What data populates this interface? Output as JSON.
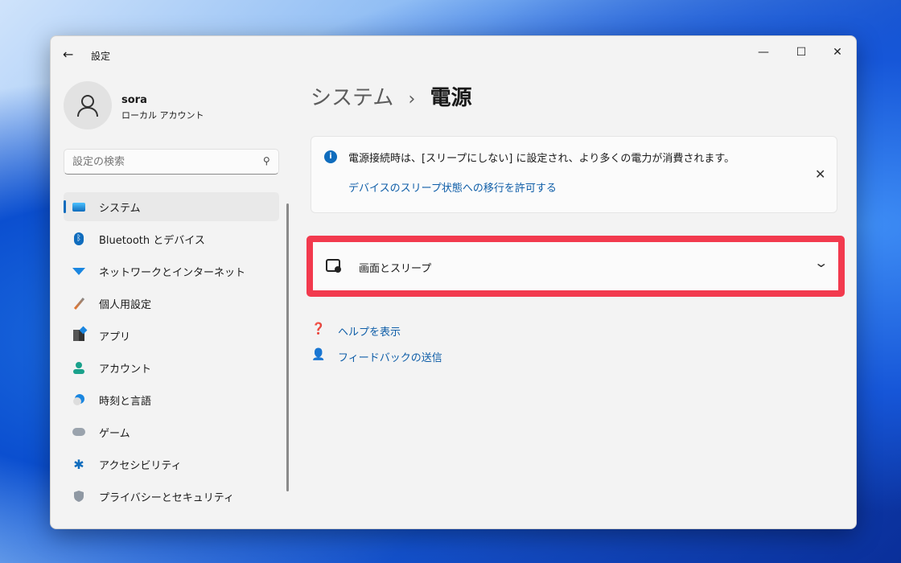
{
  "window": {
    "title": "設定",
    "back": "←",
    "minimize": "—",
    "maximize": "☐",
    "close": "✕"
  },
  "user": {
    "name": "sora",
    "type": "ローカル アカウント"
  },
  "search": {
    "placeholder": "設定の検索"
  },
  "sidebar": {
    "items": [
      {
        "label": "システム",
        "icon": "system-icon",
        "selected": true
      },
      {
        "label": "Bluetooth とデバイス",
        "icon": "bluetooth-icon"
      },
      {
        "label": "ネットワークとインターネット",
        "icon": "wifi-icon"
      },
      {
        "label": "個人用設定",
        "icon": "brush-icon"
      },
      {
        "label": "アプリ",
        "icon": "apps-icon"
      },
      {
        "label": "アカウント",
        "icon": "account-icon"
      },
      {
        "label": "時刻と言語",
        "icon": "clock-globe-icon"
      },
      {
        "label": "ゲーム",
        "icon": "gamepad-icon"
      },
      {
        "label": "アクセシビリティ",
        "icon": "accessibility-icon"
      },
      {
        "label": "プライバシーとセキュリティ",
        "icon": "shield-icon"
      }
    ]
  },
  "header": {
    "parent": "システム",
    "separator": "›",
    "current": "電源"
  },
  "info": {
    "message": "電源接続時は、[スリープにしない] に設定され、より多くの電力が消費されます。",
    "link": "デバイスのスリープ状態への移行を許可する"
  },
  "screen_sleep": {
    "label": "画面とスリープ"
  },
  "help": {
    "get_help": "ヘルプを表示",
    "feedback": "フィードバックの送信"
  },
  "colors": {
    "accent": "#0f6cbd",
    "highlight": "#f23a4e"
  }
}
